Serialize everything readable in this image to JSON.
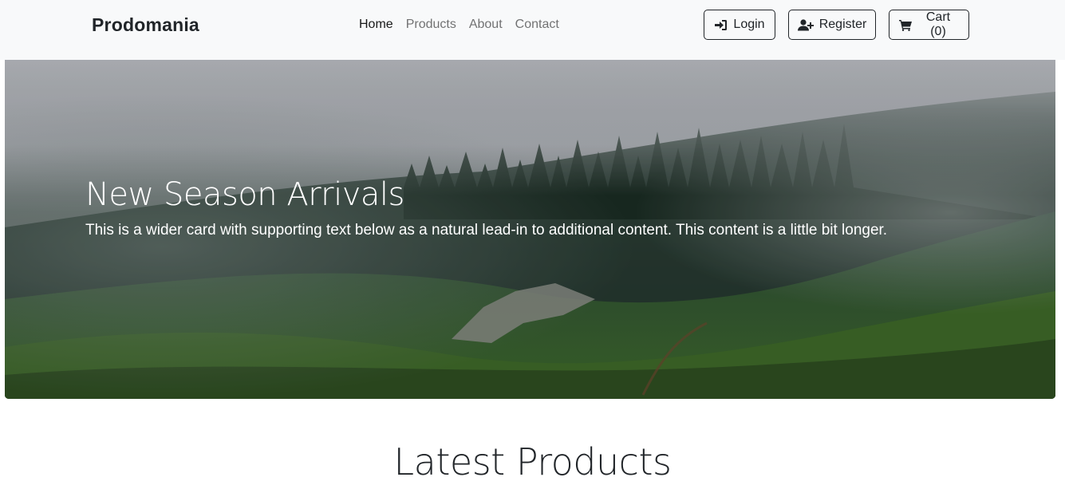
{
  "navbar": {
    "brand": "Prodomania",
    "links": [
      {
        "label": "Home",
        "active": true
      },
      {
        "label": "Products",
        "active": false
      },
      {
        "label": "About",
        "active": false
      },
      {
        "label": "Contact",
        "active": false
      }
    ],
    "buttons": {
      "login": {
        "label": "Login",
        "icon": "sign-in-icon"
      },
      "register": {
        "label": "Register",
        "icon": "user-plus-icon"
      },
      "cart": {
        "label": "Cart (0)",
        "icon": "shopping-cart-icon"
      }
    }
  },
  "hero": {
    "title": "New Season Arrivals",
    "text": "This is a wider card with supporting text below as a natural lead-in to additional content. This content is a little bit longer.",
    "image": "misty-forest-hillside"
  },
  "section": {
    "title": "Latest Products"
  },
  "colors": {
    "navbar_bg": "#f8f9fa",
    "text_dark": "#212529",
    "hero_text": "#ffffff"
  }
}
